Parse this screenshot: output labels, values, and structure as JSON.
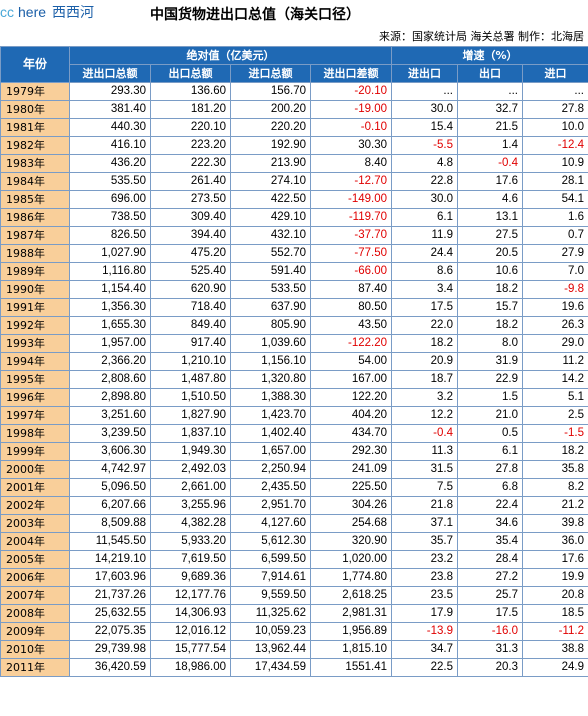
{
  "header": {
    "logo_cc": "cc",
    "logo_here": "here",
    "logo_cn": "西西河",
    "title": "中国货物进出口总值（海关口径）",
    "source": "来源：国家统计局 海关总署 制作：北海居"
  },
  "table": {
    "year_header": "年份",
    "group_absolute": "绝对值（亿美元）",
    "group_growth": "增速（%）",
    "columns": [
      "进出口总额",
      "出口总额",
      "进口总额",
      "进出口差额",
      "进出口",
      "出口",
      "进口"
    ],
    "rows": [
      [
        "1979年",
        "293.30",
        "136.60",
        "156.70",
        "-20.10",
        "...",
        "...",
        "..."
      ],
      [
        "1980年",
        "381.40",
        "181.20",
        "200.20",
        "-19.00",
        "30.0",
        "32.7",
        "27.8"
      ],
      [
        "1981年",
        "440.30",
        "220.10",
        "220.20",
        "-0.10",
        "15.4",
        "21.5",
        "10.0"
      ],
      [
        "1982年",
        "416.10",
        "223.20",
        "192.90",
        "30.30",
        "-5.5",
        "1.4",
        "-12.4"
      ],
      [
        "1983年",
        "436.20",
        "222.30",
        "213.90",
        "8.40",
        "4.8",
        "-0.4",
        "10.9"
      ],
      [
        "1984年",
        "535.50",
        "261.40",
        "274.10",
        "-12.70",
        "22.8",
        "17.6",
        "28.1"
      ],
      [
        "1985年",
        "696.00",
        "273.50",
        "422.50",
        "-149.00",
        "30.0",
        "4.6",
        "54.1"
      ],
      [
        "1986年",
        "738.50",
        "309.40",
        "429.10",
        "-119.70",
        "6.1",
        "13.1",
        "1.6"
      ],
      [
        "1987年",
        "826.50",
        "394.40",
        "432.10",
        "-37.70",
        "11.9",
        "27.5",
        "0.7"
      ],
      [
        "1988年",
        "1,027.90",
        "475.20",
        "552.70",
        "-77.50",
        "24.4",
        "20.5",
        "27.9"
      ],
      [
        "1989年",
        "1,116.80",
        "525.40",
        "591.40",
        "-66.00",
        "8.6",
        "10.6",
        "7.0"
      ],
      [
        "1990年",
        "1,154.40",
        "620.90",
        "533.50",
        "87.40",
        "3.4",
        "18.2",
        "-9.8"
      ],
      [
        "1991年",
        "1,356.30",
        "718.40",
        "637.90",
        "80.50",
        "17.5",
        "15.7",
        "19.6"
      ],
      [
        "1992年",
        "1,655.30",
        "849.40",
        "805.90",
        "43.50",
        "22.0",
        "18.2",
        "26.3"
      ],
      [
        "1993年",
        "1,957.00",
        "917.40",
        "1,039.60",
        "-122.20",
        "18.2",
        "8.0",
        "29.0"
      ],
      [
        "1994年",
        "2,366.20",
        "1,210.10",
        "1,156.10",
        "54.00",
        "20.9",
        "31.9",
        "11.2"
      ],
      [
        "1995年",
        "2,808.60",
        "1,487.80",
        "1,320.80",
        "167.00",
        "18.7",
        "22.9",
        "14.2"
      ],
      [
        "1996年",
        "2,898.80",
        "1,510.50",
        "1,388.30",
        "122.20",
        "3.2",
        "1.5",
        "5.1"
      ],
      [
        "1997年",
        "3,251.60",
        "1,827.90",
        "1,423.70",
        "404.20",
        "12.2",
        "21.0",
        "2.5"
      ],
      [
        "1998年",
        "3,239.50",
        "1,837.10",
        "1,402.40",
        "434.70",
        "-0.4",
        "0.5",
        "-1.5"
      ],
      [
        "1999年",
        "3,606.30",
        "1,949.30",
        "1,657.00",
        "292.30",
        "11.3",
        "6.1",
        "18.2"
      ],
      [
        "2000年",
        "4,742.97",
        "2,492.03",
        "2,250.94",
        "241.09",
        "31.5",
        "27.8",
        "35.8"
      ],
      [
        "2001年",
        "5,096.50",
        "2,661.00",
        "2,435.50",
        "225.50",
        "7.5",
        "6.8",
        "8.2"
      ],
      [
        "2002年",
        "6,207.66",
        "3,255.96",
        "2,951.70",
        "304.26",
        "21.8",
        "22.4",
        "21.2"
      ],
      [
        "2003年",
        "8,509.88",
        "4,382.28",
        "4,127.60",
        "254.68",
        "37.1",
        "34.6",
        "39.8"
      ],
      [
        "2004年",
        "11,545.50",
        "5,933.20",
        "5,612.30",
        "320.90",
        "35.7",
        "35.4",
        "36.0"
      ],
      [
        "2005年",
        "14,219.10",
        "7,619.50",
        "6,599.50",
        "1,020.00",
        "23.2",
        "28.4",
        "17.6"
      ],
      [
        "2006年",
        "17,603.96",
        "9,689.36",
        "7,914.61",
        "1,774.80",
        "23.8",
        "27.2",
        "19.9"
      ],
      [
        "2007年",
        "21,737.26",
        "12,177.76",
        "9,559.50",
        "2,618.25",
        "23.5",
        "25.7",
        "20.8"
      ],
      [
        "2008年",
        "25,632.55",
        "14,306.93",
        "11,325.62",
        "2,981.31",
        "17.9",
        "17.5",
        "18.5"
      ],
      [
        "2009年",
        "22,075.35",
        "12,016.12",
        "10,059.23",
        "1,956.89",
        "-13.9",
        "-16.0",
        "-11.2"
      ],
      [
        "2010年",
        "29,739.98",
        "15,777.54",
        "13,962.44",
        "1,815.10",
        "34.7",
        "31.3",
        "38.8"
      ],
      [
        "2011年",
        "36,420.59",
        "18,986.00",
        "17,434.59",
        "1551.41",
        "22.5",
        "20.3",
        "24.9"
      ]
    ]
  },
  "colors": {
    "header_bg": "#1f69b4",
    "year_bg": "#f9cf9a",
    "negative_text": "#e00000"
  }
}
